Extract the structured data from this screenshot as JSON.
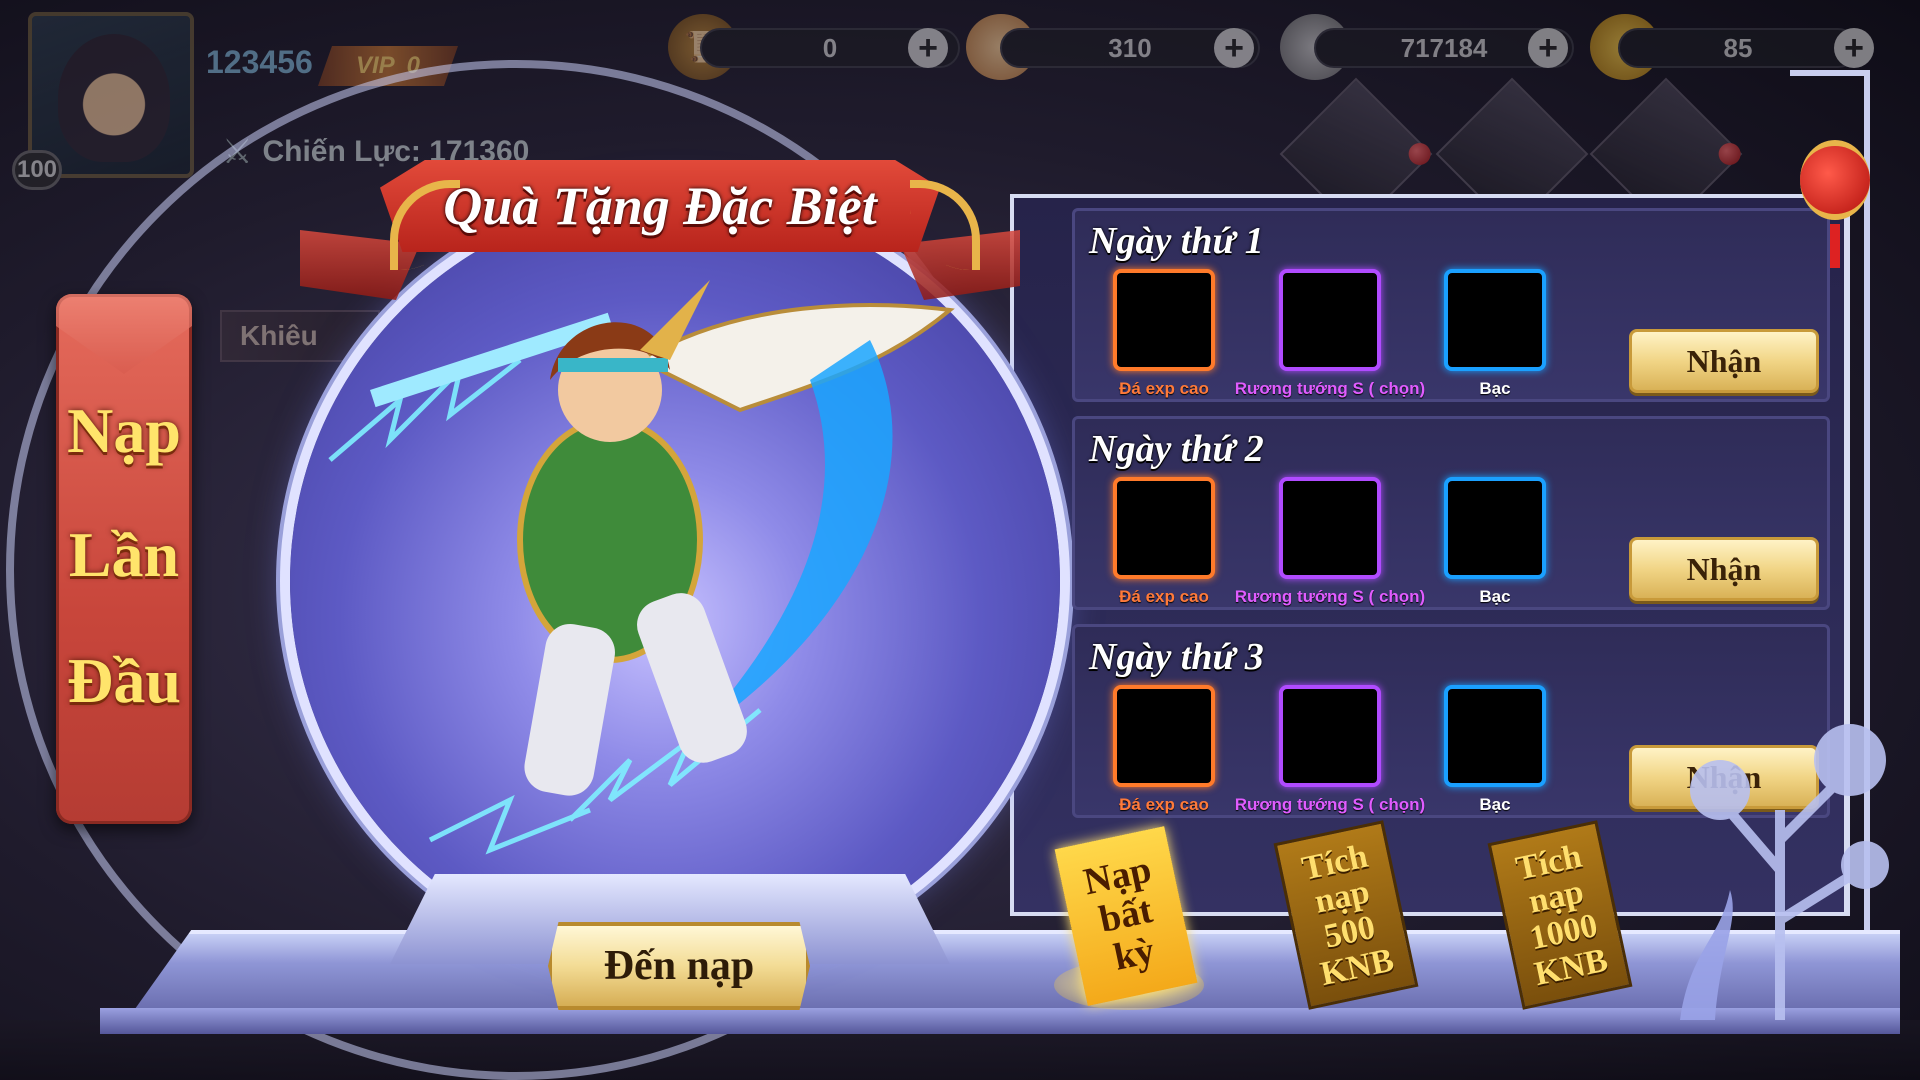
{
  "hud": {
    "player_id": "123456",
    "vip_label": "VIP",
    "vip_level": "0",
    "level": "100",
    "power_text": "Chiến Lực: 171360",
    "resources": [
      {
        "icon": "scroll-icon",
        "value": "0"
      },
      {
        "icon": "peach-icon",
        "value": "310"
      },
      {
        "icon": "silver-coin-icon",
        "value": "717184"
      },
      {
        "icon": "gold-ingot-icon",
        "value": "85"
      }
    ],
    "bg_tab_label": "Khiêu"
  },
  "side_tab": {
    "line1": "Nạp",
    "line2": "Lần",
    "line3": "Đầu"
  },
  "title": "Quà Tặng Đặc Biệt",
  "go_button": "Đến nạp",
  "days": [
    {
      "title": "Ngày thứ 1",
      "items": [
        {
          "label": "Đá exp cao",
          "rarity": "orange"
        },
        {
          "label": "Rương tướng S ( chọn)",
          "rarity": "purple"
        },
        {
          "label": "Bạc",
          "rarity": "blue"
        }
      ],
      "claim": "Nhận"
    },
    {
      "title": "Ngày thứ 2",
      "items": [
        {
          "label": "Đá exp cao",
          "rarity": "orange"
        },
        {
          "label": "Rương tướng S ( chọn)",
          "rarity": "purple"
        },
        {
          "label": "Bạc",
          "rarity": "blue"
        }
      ],
      "claim": "Nhận"
    },
    {
      "title": "Ngày thứ 3",
      "items": [
        {
          "label": "Đá exp cao",
          "rarity": "orange"
        },
        {
          "label": "Rương tướng S ( chọn)",
          "rarity": "purple"
        },
        {
          "label": "Bạc",
          "rarity": "blue"
        }
      ],
      "claim": "Nhận"
    }
  ],
  "bottom_tabs": [
    {
      "lines": [
        "Nạp",
        "bất",
        "kỳ"
      ],
      "active": true
    },
    {
      "lines": [
        "Tích",
        "nạp",
        "500",
        "KNB"
      ],
      "active": false
    },
    {
      "lines": [
        "Tích",
        "nạp",
        "1000",
        "KNB"
      ],
      "active": false
    }
  ],
  "colors": {
    "rarity_orange": "#ff7a2a",
    "rarity_purple": "#b04bff",
    "rarity_blue": "#1aa0ff",
    "title_ribbon": "#d2362a",
    "gold_button": "#f1d586"
  }
}
